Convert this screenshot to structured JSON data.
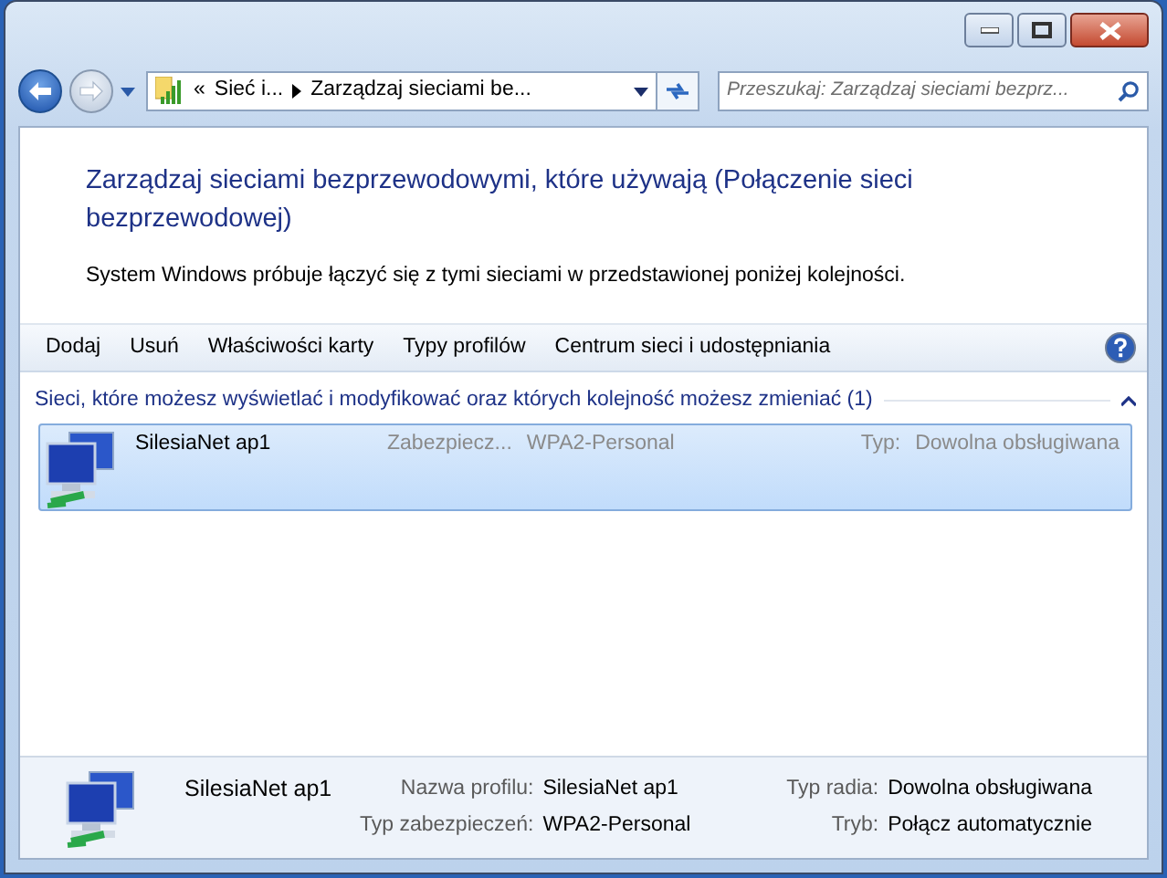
{
  "window": {
    "buttons": [
      {
        "kind": "minimize"
      },
      {
        "kind": "maximize"
      },
      {
        "kind": "close"
      }
    ]
  },
  "address_bar": {
    "overflow": "«",
    "crumbs": [
      "Sieć i...",
      "Zarządzaj sieciami be..."
    ]
  },
  "search": {
    "placeholder": "Przeszukaj: Zarządzaj sieciami bezprz..."
  },
  "heading": "Zarządzaj sieciami bezprzewodowymi, które używają (Połączenie sieci bezprzewodowej)",
  "description": "System Windows próbuje łączyć się z tymi sieciami w przedstawionej poniżej kolejności.",
  "toolbar": [
    "Dodaj",
    "Usuń",
    "Właściwości karty",
    "Typy profilów",
    "Centrum sieci i udostępniania"
  ],
  "group": {
    "title": "Sieci, które możesz wyświetlać i modyfikować oraz których kolejność możesz zmieniać (1)",
    "expanded": true
  },
  "networks": [
    {
      "name": "SilesiaNet ap1",
      "security_label": "Zabezpiecz...",
      "security": "WPA2-Personal",
      "type_label": "Typ:",
      "type": "Dowolna obsługiwana",
      "selected": true
    }
  ],
  "details": {
    "name": "SilesiaNet ap1",
    "fields": [
      {
        "label": "Nazwa profilu:",
        "value": "SilesiaNet ap1"
      },
      {
        "label": "Typ radia:",
        "value": "Dowolna obsługiwana"
      },
      {
        "label": "Typ zabezpieczeń:",
        "value": "WPA2-Personal"
      },
      {
        "label": "Tryb:",
        "value": "Połącz automatycznie"
      }
    ]
  }
}
